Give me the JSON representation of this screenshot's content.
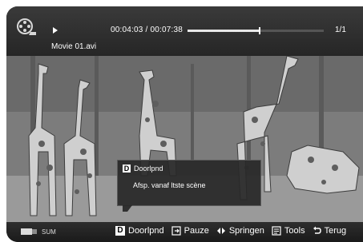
{
  "topbar": {
    "elapsed_total": "00:04:03 / 00:07:38",
    "progress_fraction": 0.53,
    "page_count": "1/1",
    "filename": "Movie 01.avi"
  },
  "popup": {
    "key_letter": "D",
    "title": "Doorlpnd",
    "description": "Afsp. vanaf ltste scène"
  },
  "bottombar": {
    "device_label": "SUM",
    "controls": [
      {
        "icon": "d-key-icon",
        "label": "Doorlpnd",
        "key": "D"
      },
      {
        "icon": "pause-icon",
        "label": "Pauze"
      },
      {
        "icon": "left-right-arrows-icon",
        "label": "Springen"
      },
      {
        "icon": "tools-icon",
        "label": "Tools"
      },
      {
        "icon": "return-icon",
        "label": "Terug"
      }
    ]
  }
}
